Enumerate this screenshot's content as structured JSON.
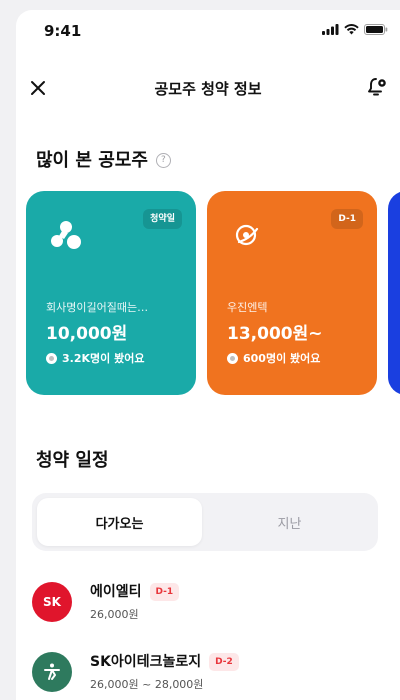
{
  "status_bar": {
    "time": "9:41"
  },
  "header": {
    "title": "공모주 청약 정보"
  },
  "popular": {
    "heading": "많이 본 공모주",
    "help_glyph": "?",
    "cards": [
      {
        "badge": "청약일",
        "name": "회사명이길어질때는…",
        "price": "10,000원",
        "views": "3.2K명이 봤어요",
        "color": "#1aaaa8"
      },
      {
        "badge": "D-1",
        "name": "우진엔텍",
        "price": "13,000원~",
        "views": "600명이 봤어요",
        "color": "#f0731f"
      }
    ],
    "peek_card_color": "#1a3fe0"
  },
  "schedule": {
    "heading": "청약 일정",
    "tabs": [
      {
        "label": "다가오는",
        "selected": true
      },
      {
        "label": "지난",
        "selected": false
      }
    ],
    "items": [
      {
        "logo_text": "SK",
        "name": "에이엘티",
        "dday": "D-1",
        "price": "26,000원",
        "logo_color": "#e0152c"
      },
      {
        "logo_text": "",
        "name": "SK아이테크놀로지",
        "dday": "D-2",
        "price": "26,000원 ~ 28,000원",
        "logo_color": "#2e7a5e"
      }
    ]
  },
  "colors": {
    "dday_text": "#e8353b",
    "dday_bg": "#fde7e8"
  }
}
